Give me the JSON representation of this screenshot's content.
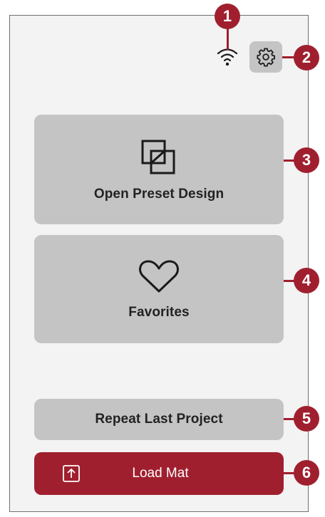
{
  "status": {
    "wifi_icon": "wifi-icon",
    "settings_icon": "gear-icon"
  },
  "tiles": {
    "open_preset": {
      "label": "Open Preset Design",
      "icon": "layers-square-icon"
    },
    "favorites": {
      "label": "Favorites",
      "icon": "heart-icon"
    },
    "repeat_last": {
      "label": "Repeat Last Project"
    },
    "load_mat": {
      "label": "Load Mat",
      "icon": "upload-arrow-icon"
    }
  },
  "callouts": [
    "1",
    "2",
    "3",
    "4",
    "5",
    "6"
  ],
  "colors": {
    "accent": "#a01f2e",
    "tile": "#c4c4c4",
    "screen": "#f3f3f3",
    "text": "#222222"
  }
}
